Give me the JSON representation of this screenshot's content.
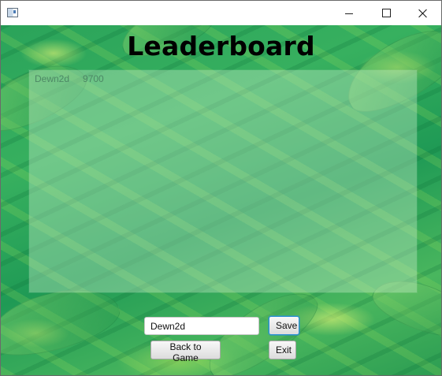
{
  "window": {
    "title": "",
    "controls": {
      "minimize_icon": "minimize-icon",
      "maximize_icon": "maximize-icon",
      "close_icon": "close-icon"
    }
  },
  "page": {
    "title": "Leaderboard",
    "background": "leafy green foliage",
    "colors": {
      "title": "#000000",
      "panel": "rgba(205,240,205,0.38)",
      "entry_text": "#467d5f"
    }
  },
  "leaderboard": {
    "entries": [
      {
        "name": "Dewn2d",
        "score": "9700"
      }
    ]
  },
  "form": {
    "name_value": "Dewn2d",
    "save_label": "Save",
    "back_label": "Back to Game",
    "exit_label": "Exit"
  }
}
